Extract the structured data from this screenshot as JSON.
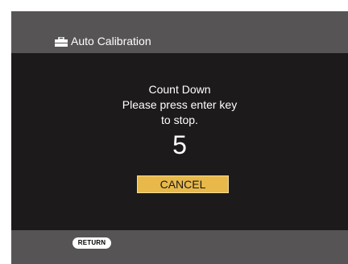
{
  "header": {
    "title": "Auto Calibration",
    "icon": "toolbox-icon"
  },
  "dialog": {
    "line1": "Count Down",
    "line2": "Please press enter key",
    "line3": "to stop.",
    "countdown": "5",
    "cancel_label": "CANCEL"
  },
  "footer": {
    "return_label": "RETURN"
  },
  "colors": {
    "header_bg": "#565455",
    "body_bg": "#1c1a1b",
    "button_highlight": "#e8b94a"
  }
}
